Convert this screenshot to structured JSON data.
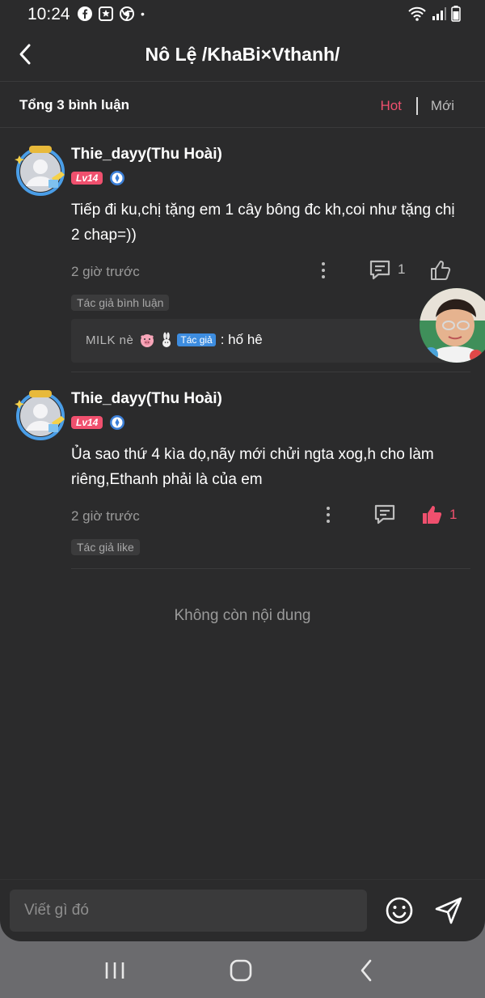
{
  "status_bar": {
    "time": "10:24",
    "dot": "•"
  },
  "header": {
    "title": "Nô Lệ /KhaBi×Vthanh/"
  },
  "summary": {
    "total": "Tổng 3 bình luận",
    "sort_hot": "Hot",
    "sort_new": "Mới"
  },
  "comments": [
    {
      "username": "Thie_dayy(Thu Hoài)",
      "level": "Lv14",
      "text": "Tiếp đi ku,chị tặng em 1 cây bông đc kh,coi như tặng chị 2 chap=))",
      "time": "2 giờ trước",
      "reply_count": "1",
      "tag": "Tác giả bình luận",
      "reply": {
        "name": "MILK nè",
        "author_badge": "Tác giả",
        "text": ": hố hê"
      }
    },
    {
      "username": "Thie_dayy(Thu Hoài)",
      "level": "Lv14",
      "text": "Ủa sao thứ 4 kìa dọ,nãy mới chửi ngta xog,h cho làm riêng,Ethanh phải là của em",
      "time": "2 giờ trước",
      "like_count": "1",
      "tag": "Tác giả like"
    }
  ],
  "no_more": "Không còn nội dung",
  "input": {
    "placeholder": "Viết gì đó"
  },
  "colors": {
    "accent": "#f0506e",
    "background": "#2b2b2c",
    "author_badge": "#3d8de0"
  }
}
